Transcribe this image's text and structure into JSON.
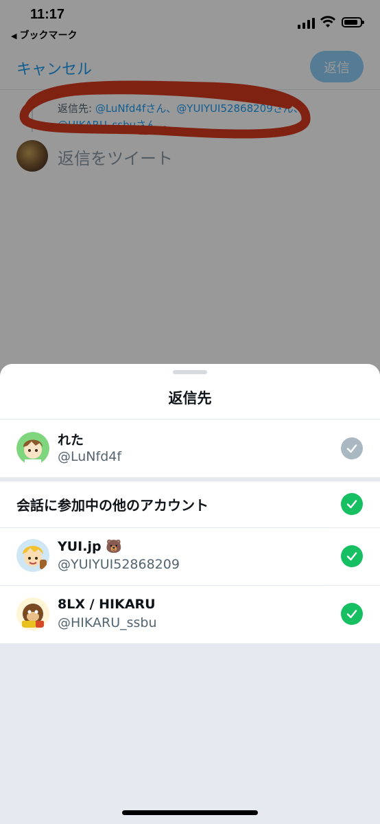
{
  "status_bar": {
    "time": "11:17",
    "back_app": "ブックマーク",
    "icons": [
      "cellular-signal-icon",
      "wifi-icon",
      "battery-icon"
    ]
  },
  "composer": {
    "cancel_label": "キャンセル",
    "reply_button_label": "返信",
    "reply_to_prefix": "返信先: ",
    "reply_to_handles": "@LuNfd4fさん、@YUIYUI52868209さん、@HIKARU_ssbuさん",
    "placeholder": "返信をツイート"
  },
  "sheet": {
    "title": "返信先",
    "primary": {
      "name": "れた",
      "handle": "@LuNfd4f",
      "checked": true,
      "check_color": "#aab8c2"
    },
    "group_label": "会話に参加中の他のアカウント",
    "others": [
      {
        "name": "YUI.jp 🐻",
        "handle": "@YUIYUI52868209",
        "checked": true
      },
      {
        "name": "8LX / HIKARU",
        "handle": "@HIKARU_ssbu",
        "checked": true
      }
    ]
  },
  "colors": {
    "accent": "#1d9bf0",
    "check_green": "#17bf63",
    "annotation_red": "#d63a1e"
  }
}
